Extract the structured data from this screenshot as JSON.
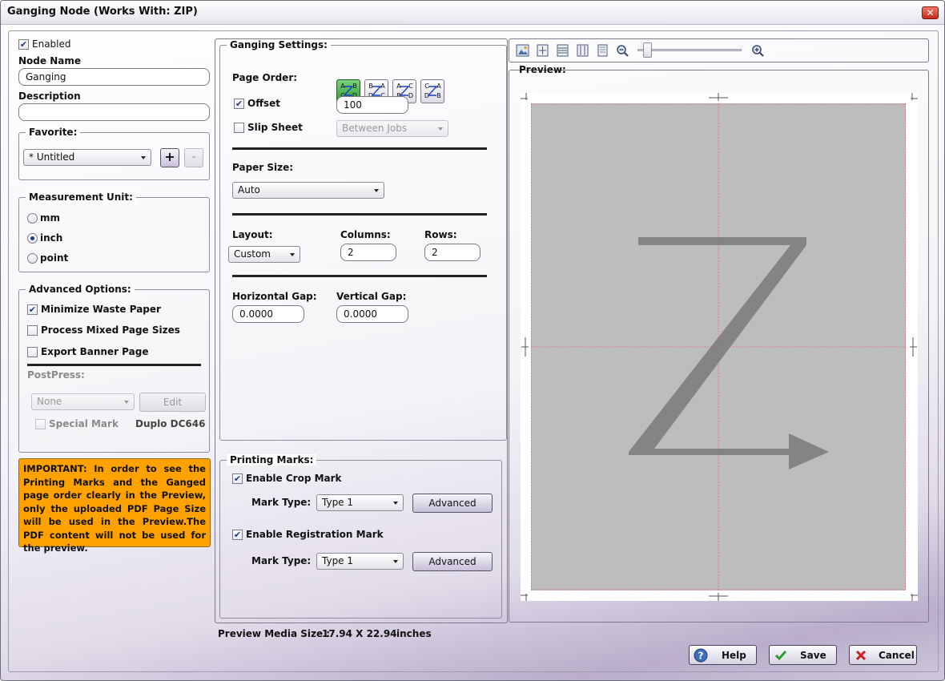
{
  "window": {
    "title": "Ganging Node (Works With: ZIP)",
    "close_glyph": "✕"
  },
  "left": {
    "enabled_label": "Enabled",
    "enabled_checked": true,
    "node_name_label": "Node Name",
    "node_name_value": "Ganging",
    "description_label": "Description",
    "description_value": "",
    "favorite": {
      "title": "Favorite:",
      "selected": "* Untitled",
      "add": "+",
      "remove": "-"
    },
    "measurement": {
      "title": "Measurement Unit:",
      "options": [
        {
          "label": "mm",
          "selected": false
        },
        {
          "label": "inch",
          "selected": true
        },
        {
          "label": "point",
          "selected": false
        }
      ]
    },
    "advanced": {
      "title": "Advanced Options:",
      "options": [
        {
          "label": "Minimize Waste Paper",
          "checked": true
        },
        {
          "label": "Process Mixed Page Sizes",
          "checked": false
        },
        {
          "label": "Export Banner Page",
          "checked": false
        }
      ],
      "postpress_label": "PostPress:",
      "postpress_value": "None",
      "edit_label": "Edit",
      "special_mark_label": "Special Mark",
      "device_label": "Duplo DC646"
    },
    "important_text": "IMPORTANT: In order to see the Printing Marks and the Ganged page order clearly in the Preview, only the uploaded PDF Page Size will be used in the Preview.The PDF content will not be used for the preview."
  },
  "ganging": {
    "title": "Ganging Settings:",
    "page_order_label": "Page Order:",
    "page_orders": [
      {
        "name": "page-order-z",
        "letters": [
          "A",
          "B",
          "C",
          "D"
        ],
        "active": true
      },
      {
        "name": "page-order-reverse-z",
        "letters": [
          "B",
          "A",
          "D",
          "C"
        ],
        "active": false
      },
      {
        "name": "page-order-n",
        "letters": [
          "A",
          "C",
          "B",
          "D"
        ],
        "active": false
      },
      {
        "name": "page-order-reverse-n",
        "letters": [
          "C",
          "A",
          "D",
          "B"
        ],
        "active": false
      }
    ],
    "offset_label": "Offset",
    "offset_checked": true,
    "offset_value": "100",
    "slip_sheet_label": "Slip Sheet",
    "slip_sheet_checked": false,
    "slip_sheet_value": "Between Jobs",
    "paper_size_label": "Paper Size:",
    "paper_size_value": "Auto",
    "layout_label": "Layout:",
    "layout_value": "Custom",
    "columns_label": "Columns:",
    "columns_value": "2",
    "rows_label": "Rows:",
    "rows_value": "2",
    "hgap_label": "Horizontal Gap:",
    "hgap_value": "0.0000",
    "vgap_label": "Vertical Gap:",
    "vgap_value": "0.0000"
  },
  "printing_marks": {
    "title": "Printing Marks:",
    "crop_label": "Enable Crop Mark",
    "crop_checked": true,
    "crop_mark_type_label": "Mark Type:",
    "crop_mark_type_value": "Type 1",
    "crop_advanced": "Advanced",
    "reg_label": "Enable Registration Mark",
    "reg_checked": true,
    "reg_mark_type_label": "Mark Type:",
    "reg_mark_type_value": "Type 1",
    "reg_advanced": "Advanced"
  },
  "preview": {
    "title": "Preview:",
    "zoom_level": 0.05,
    "media_size_label": "Preview Media Size :",
    "media_size_value": "17.94 X 22.94",
    "media_size_unit": "inches",
    "page_color": "#bdbdbd",
    "guide_color": "#e07070"
  },
  "footer": {
    "help": "Help",
    "save": "Save",
    "cancel": "Cancel"
  },
  "icons": [
    "close-icon",
    "fit-image-icon",
    "fit-page-icon",
    "fit-width-icon",
    "fit-height-icon",
    "actual-size-icon",
    "zoom-out-icon",
    "zoom-in-icon",
    "help-icon",
    "check-icon",
    "x-icon"
  ]
}
